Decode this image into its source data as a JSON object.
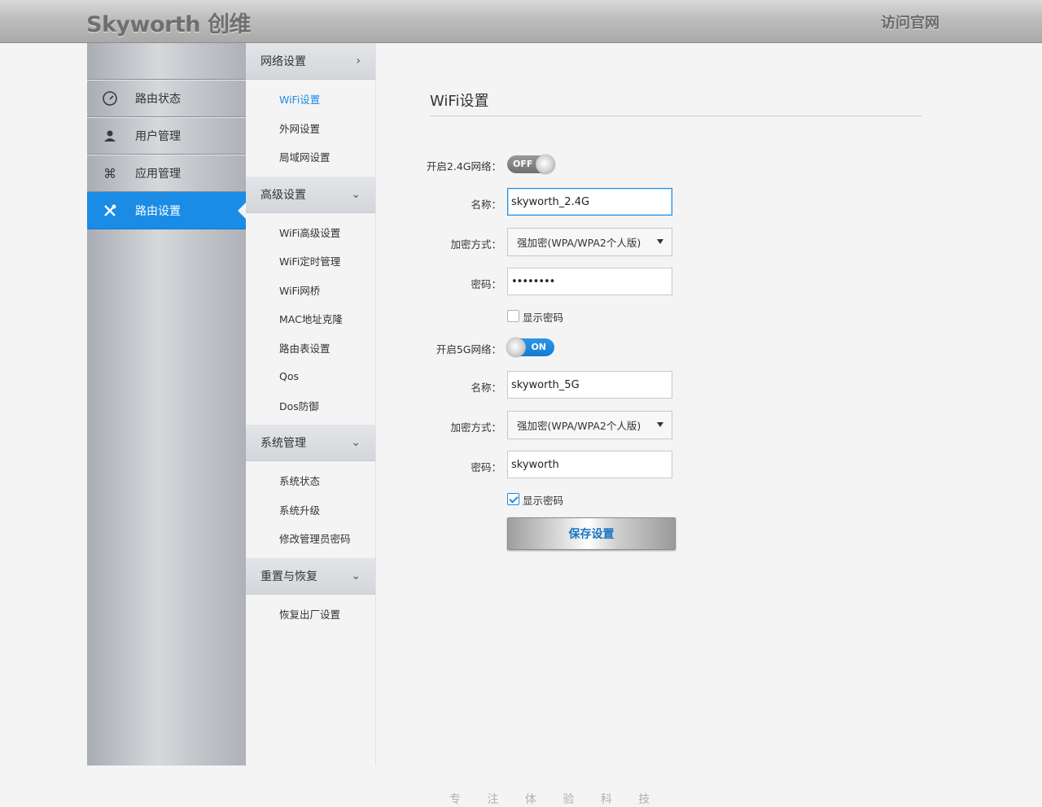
{
  "header": {
    "logo": "Skyworth 创维",
    "visit_link": "访问官网"
  },
  "sidebar": {
    "items": [
      {
        "label": "路由状态",
        "icon": "gauge-icon"
      },
      {
        "label": "用户管理",
        "icon": "user-icon"
      },
      {
        "label": "应用管理",
        "icon": "command-icon"
      },
      {
        "label": "路由设置",
        "icon": "tools-icon",
        "active": true
      }
    ]
  },
  "submenu": {
    "sections": [
      {
        "title": "网络设置",
        "chevron": "›",
        "links": [
          "WiFi设置",
          "外网设置",
          "局域网设置"
        ]
      },
      {
        "title": "高级设置",
        "chevron": "⌄",
        "links": [
          "WiFi高级设置",
          "WiFi定时管理",
          "WiFi网桥",
          "MAC地址克隆",
          "路由表设置",
          "Qos",
          "Dos防御"
        ]
      },
      {
        "title": "系统管理",
        "chevron": "⌄",
        "links": [
          "系统状态",
          "系统升级",
          "修改管理员密码"
        ]
      },
      {
        "title": "重置与恢复",
        "chevron": "⌄",
        "links": [
          "恢复出厂设置"
        ]
      }
    ]
  },
  "main": {
    "title": "WiFi设置",
    "band24": {
      "enable_label": "开启2.4G网络：",
      "toggle_text": "OFF",
      "name_label": "名称：",
      "name_value": "skyworth_2.4G",
      "encrypt_label": "加密方式：",
      "encrypt_value": "强加密(WPA/WPA2个人版)",
      "password_label": "密码：",
      "password_value": "••••••••",
      "show_password_label": "显示密码",
      "show_password_checked": false
    },
    "band5": {
      "enable_label": "开启5G网络：",
      "toggle_text": "ON",
      "name_label": "名称：",
      "name_value": "skyworth_5G",
      "encrypt_label": "加密方式：",
      "encrypt_value": "强加密(WPA/WPA2个人版)",
      "password_label": "密码：",
      "password_value": "skyworth",
      "show_password_label": "显示密码",
      "show_password_checked": true
    },
    "save_label": "保存设置"
  },
  "footer": {
    "text": "专 注 体 验 科 技"
  },
  "colors": {
    "accent": "#1a8ce6",
    "sidebar_active": "#1a8ce6"
  }
}
